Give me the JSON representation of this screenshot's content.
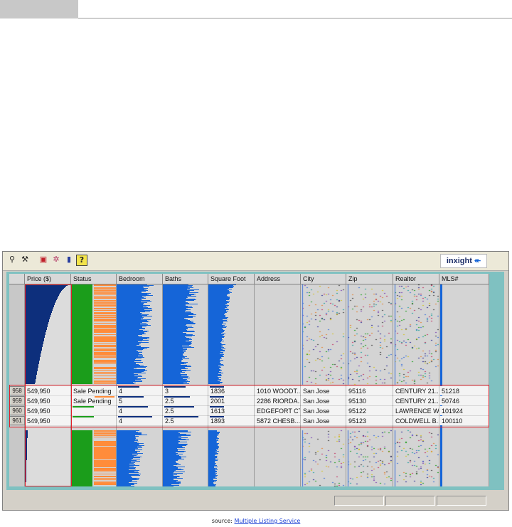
{
  "app": {
    "logo_text": "inxight",
    "toolbar_icons": [
      "pin-icon",
      "hammer-icon",
      "pdf-icon",
      "tools-icon",
      "book-icon",
      "help-icon"
    ],
    "help_label": "?"
  },
  "columns": [
    {
      "id": "price",
      "label": "Price ($)"
    },
    {
      "id": "status",
      "label": "Status"
    },
    {
      "id": "bedroom",
      "label": "Bedroom"
    },
    {
      "id": "baths",
      "label": "Baths"
    },
    {
      "id": "sqft",
      "label": "Square Foot"
    },
    {
      "id": "address",
      "label": "Address"
    },
    {
      "id": "city",
      "label": "City"
    },
    {
      "id": "zip",
      "label": "Zip"
    },
    {
      "id": "realtor",
      "label": "Realtor"
    },
    {
      "id": "mls",
      "label": "MLS#"
    }
  ],
  "rows": [
    {
      "num": "958",
      "price": "549,950",
      "status": "Sale Pending",
      "bedroom": "4",
      "baths": "3",
      "sqft": "1836",
      "address": "1010 WOODT...",
      "city": "San Jose",
      "zip": "95116",
      "realtor": "CENTURY 21...",
      "mls": "51218"
    },
    {
      "num": "959",
      "price": "549,950",
      "status": "Sale Pending",
      "bedroom": "5",
      "baths": "2.5",
      "sqft": "2001",
      "address": "2286 RIORDA...",
      "city": "San Jose",
      "zip": "95130",
      "realtor": "CENTURY 21...",
      "mls": "50746"
    },
    {
      "num": "960",
      "price": "549,950",
      "status": "",
      "bedroom": "4",
      "baths": "2.5",
      "sqft": "1613",
      "address": "EDGEFORT CT",
      "city": "San Jose",
      "zip": "95122",
      "realtor": "LAWRENCE W...",
      "mls": "101924"
    },
    {
      "num": "961",
      "price": "549,950",
      "status": "",
      "bedroom": "4",
      "baths": "2.5",
      "sqft": "1893",
      "address": "5872 CHESB...",
      "city": "San Jose",
      "zip": "95123",
      "realtor": "COLDWELL B...",
      "mls": "100110"
    }
  ],
  "colors": {
    "price_bar": "#0d2f7c",
    "status_green": "#1b9d1b",
    "status_orange": "#ff8c3a",
    "numeric_bar": "#1565d8",
    "highlight_red": "#e0202a",
    "frame_teal": "#7fc1c1"
  },
  "source": {
    "label": "source:",
    "link_text": "Multiple Listing Service"
  }
}
